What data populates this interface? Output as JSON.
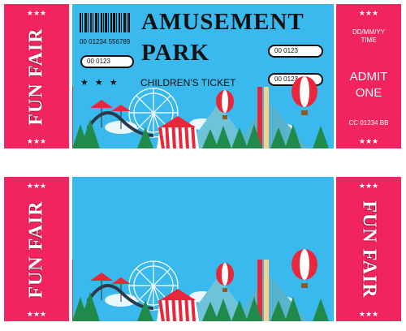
{
  "ticket_top": {
    "stub_left_text": "FUN FAIR",
    "barcode_number": "00 01234 556789",
    "title_line1": "AMUSEMENT",
    "title_line2": "PARK",
    "subtitle": "CHILDREN'S TICKET",
    "fields": [
      "00 0123",
      "00 0123",
      "00 0123"
    ],
    "right_stub": {
      "date": "DD/MM/YY",
      "time": "TIME",
      "admit_line1": "ADMIT",
      "admit_line2": "ONE",
      "code": "CC 01234 BB"
    }
  },
  "ticket_bottom": {
    "stub_left_text": "FUN FAIR",
    "stub_right_text": "FUN FAIR"
  },
  "colors": {
    "stub": "#f2245f",
    "sky": "#39b9ee",
    "tree": "#1f8a4a",
    "tent_red": "#e8283a"
  }
}
